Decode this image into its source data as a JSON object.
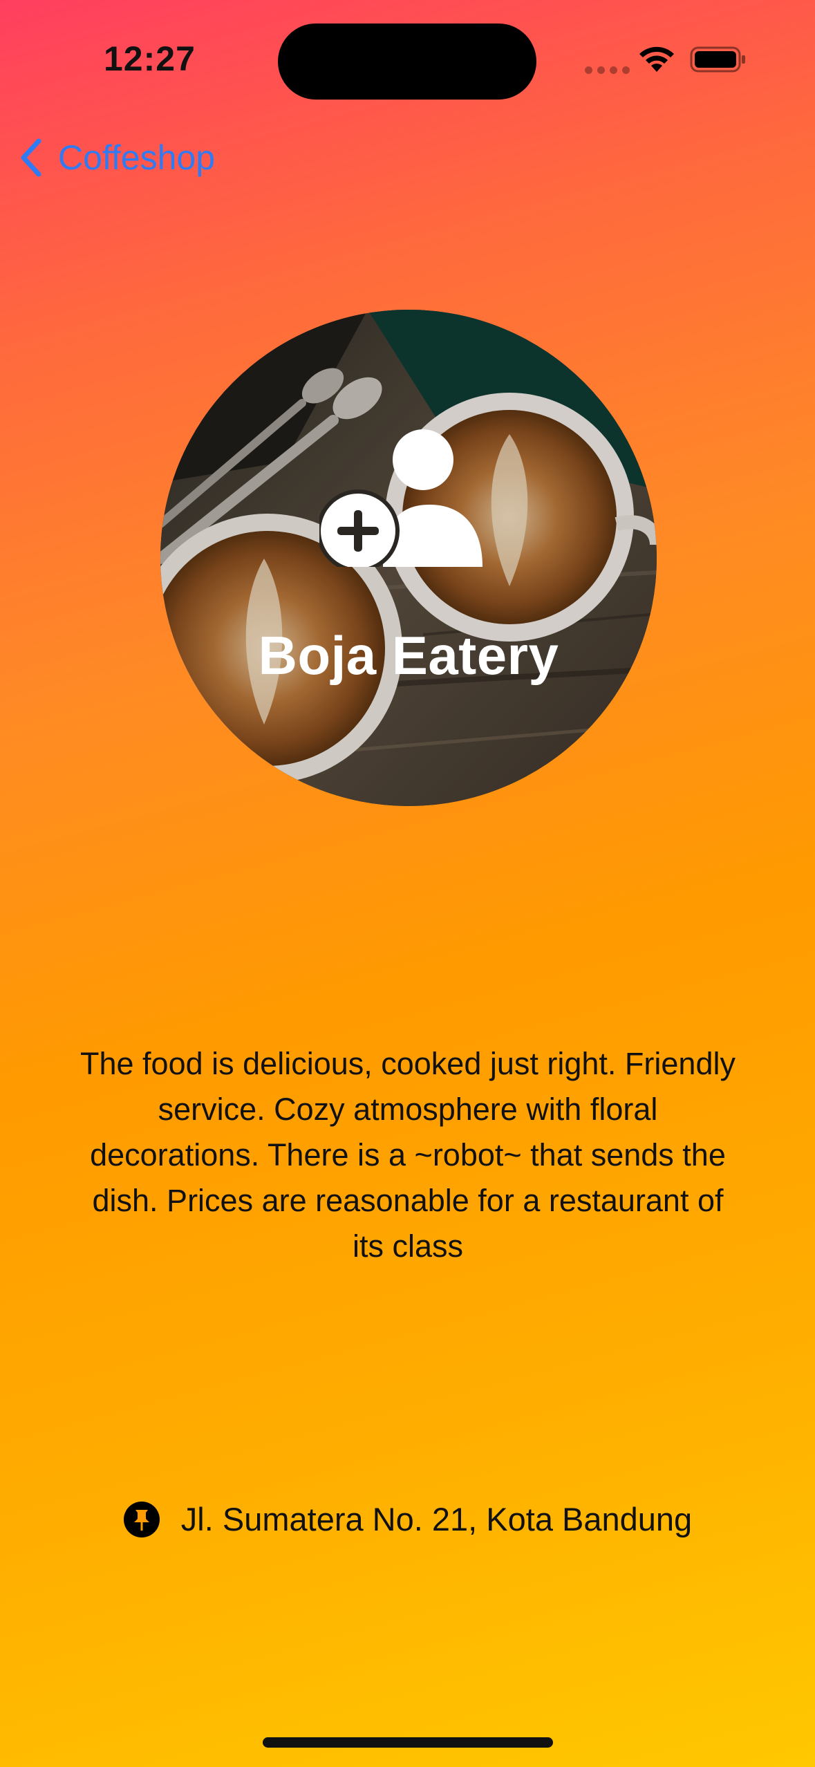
{
  "status_bar": {
    "time": "12:27"
  },
  "nav": {
    "back_label": "Coffeshop"
  },
  "place": {
    "name": "Boja Eatery",
    "description": "The food is delicious, cooked just right. Friendly service.  Cozy atmosphere with floral decorations.  There is a ~robot~ that sends the dish.  Prices are reasonable for a restaurant of its class",
    "address": "Jl. Sumatera No. 21, Kota Bandung"
  },
  "icons": {
    "back": "chevron-left-icon",
    "add_person": "person-badge-plus-icon",
    "location": "pin-icon"
  },
  "colors": {
    "link": "#2f7bf4",
    "gradient_top": "#ff3f5f",
    "gradient_bottom": "#ffc800"
  }
}
